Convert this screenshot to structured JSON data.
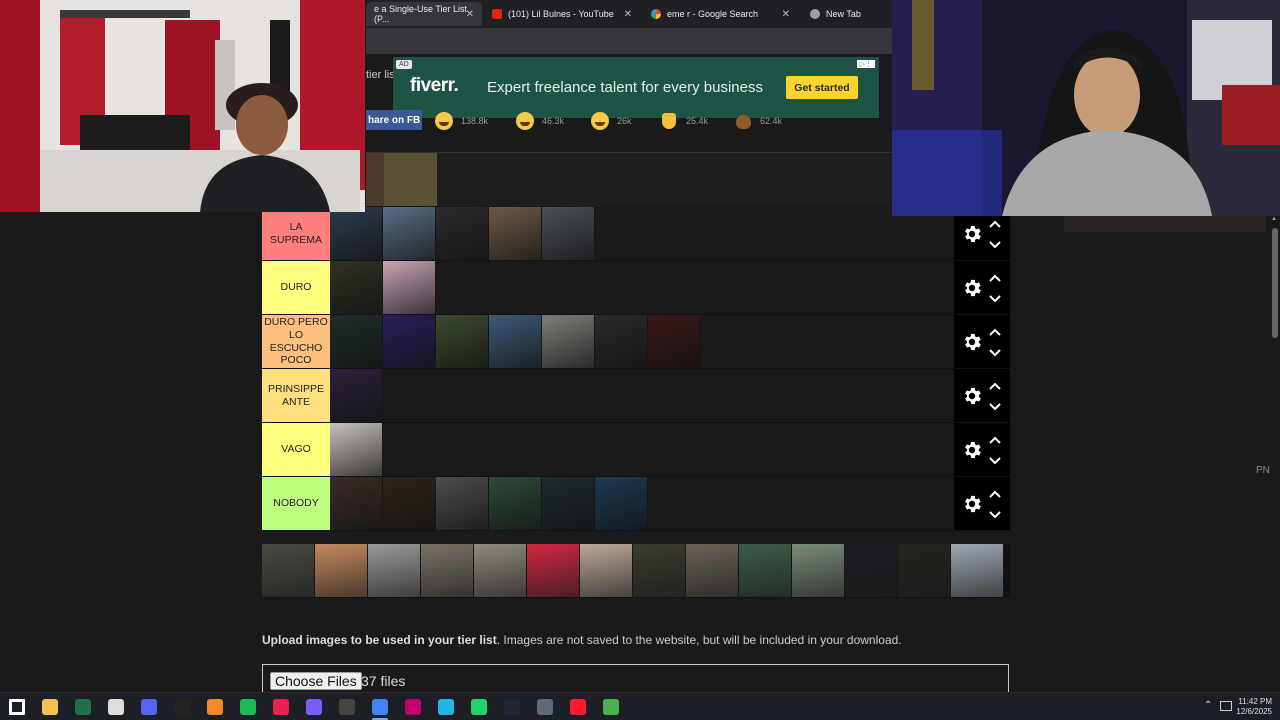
{
  "browser": {
    "tabs": [
      {
        "label": "e a Single-Use Tier List (P...",
        "active": true,
        "icon": "tiermaker-icon"
      },
      {
        "label": "(101) Lil Bulnes - YouTube",
        "active": false,
        "icon": "youtube-icon"
      },
      {
        "label": "eme r - Google Search",
        "active": false,
        "icon": "google-icon"
      },
      {
        "label": "New Tab",
        "active": false,
        "icon": "chrome-icon"
      }
    ],
    "close_glyph": "✕"
  },
  "page": {
    "title_fragment": "tier lis",
    "ad": {
      "badge": "AD",
      "logo": "fiverr.",
      "text": "Expert freelance talent for every business",
      "cta": "Get started",
      "corner": "▷⋮"
    },
    "share_label": "hare on FB",
    "reactions": [
      {
        "icon": "laugh-emoji-icon",
        "count": "138.8k"
      },
      {
        "icon": "grin-emoji-icon",
        "count": "46.3k"
      },
      {
        "icon": "tears-emoji-icon",
        "count": "26k"
      },
      {
        "icon": "raised-hands-emoji-icon",
        "count": "25.4k"
      },
      {
        "icon": "poop-emoji-icon",
        "count": "62.4k"
      }
    ]
  },
  "tiers": [
    {
      "label": "LA SUPREMA",
      "color": "#ff7f7f",
      "items": [
        "#2e3b4c",
        "#5a6f86",
        "#2b2b2b",
        "#6d5a46",
        "#4b4f55"
      ]
    },
    {
      "label": "DURO",
      "color": "#ffff7f",
      "items": [
        "#2f3224",
        "#c9a4b8"
      ]
    },
    {
      "label": "DURO PERO LO ESCUCHO POCO",
      "color": "#ffbf7f",
      "items": [
        "#1f2d2a",
        "#2a1f5c",
        "#3c4a2e",
        "#3d5a78",
        "#7e7e7a",
        "#2a2a2a",
        "#3a1818"
      ]
    },
    {
      "label": "PRINSIPPE ANTE",
      "color": "#ffdf7f",
      "items": [
        "#2a2238"
      ]
    },
    {
      "label": "VAGO",
      "color": "#ffff7f",
      "items": [
        "#c9c2bb"
      ]
    },
    {
      "label": "NOBODY",
      "color": "#bfff7f",
      "items": [
        "#3a2c26",
        "#2e2419",
        "#4d4d4d",
        "#2d4a38",
        "#1f2a2e",
        "#1d3a52"
      ]
    }
  ],
  "pool": [
    "#4a4a44",
    "#c58a5e",
    "#9a9a98",
    "#7a7268",
    "#8f8a80",
    "#d02840",
    "#bda79a",
    "#3b3a2f",
    "#6a6258",
    "#3d5c4a",
    "#7b8a7a",
    "#1c1c22",
    "#23241f",
    "#9ea7b2"
  ],
  "upload": {
    "bold": "Upload images to be used in your tier list",
    "rest": ". Images are not saved to the website, but will be included in your download.",
    "button": "Choose Files",
    "count": "37 files"
  },
  "side_text": "PN",
  "taskbar": {
    "icons": [
      "windows-start-icon",
      "file-explorer-icon",
      "excel-icon",
      "capcut-icon",
      "discord-icon",
      "scissors-icon",
      "vlc-icon",
      "spotify-icon",
      "tiktok-icon",
      "messenger-icon",
      "obs-icon",
      "chrome-icon",
      "next-icon",
      "edge-icon",
      "whatsapp-icon",
      "steam-icon",
      "4k-icon",
      "opera-icon",
      "minecraft-icon"
    ],
    "time": "11:42 PM",
    "date": "12/6/2025"
  }
}
